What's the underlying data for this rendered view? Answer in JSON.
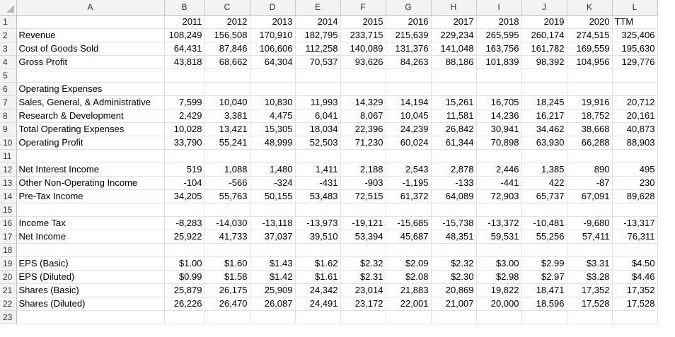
{
  "columns": [
    "A",
    "B",
    "C",
    "D",
    "E",
    "F",
    "G",
    "H",
    "I",
    "J",
    "K",
    "L"
  ],
  "rows": [
    {
      "n": "1",
      "label": "",
      "values": [
        "2011",
        "2012",
        "2013",
        "2014",
        "2015",
        "2016",
        "2017",
        "2018",
        "2019",
        "2020",
        "TTM"
      ]
    },
    {
      "n": "2",
      "label": "Revenue",
      "values": [
        "108,249",
        "156,508",
        "170,910",
        "182,795",
        "233,715",
        "215,639",
        "229,234",
        "265,595",
        "260,174",
        "274,515",
        "325,406"
      ]
    },
    {
      "n": "3",
      "label": "Cost of Goods Sold",
      "values": [
        "64,431",
        "87,846",
        "106,606",
        "112,258",
        "140,089",
        "131,376",
        "141,048",
        "163,756",
        "161,782",
        "169,559",
        "195,630"
      ]
    },
    {
      "n": "4",
      "label": "Gross Profit",
      "values": [
        "43,818",
        "68,662",
        "64,304",
        "70,537",
        "93,626",
        "84,263",
        "88,186",
        "101,839",
        "98,392",
        "104,956",
        "129,776"
      ]
    },
    {
      "n": "5",
      "label": "",
      "values": [
        "",
        "",
        "",
        "",
        "",
        "",
        "",
        "",
        "",
        "",
        ""
      ]
    },
    {
      "n": "6",
      "label": "Operating Expenses",
      "values": [
        "",
        "",
        "",
        "",
        "",
        "",
        "",
        "",
        "",
        "",
        ""
      ]
    },
    {
      "n": "7",
      "label": "Sales, General, & Administrative",
      "values": [
        "7,599",
        "10,040",
        "10,830",
        "11,993",
        "14,329",
        "14,194",
        "15,261",
        "16,705",
        "18,245",
        "19,916",
        "20,712"
      ]
    },
    {
      "n": "8",
      "label": "Research & Development",
      "values": [
        "2,429",
        "3,381",
        "4,475",
        "6,041",
        "8,067",
        "10,045",
        "11,581",
        "14,236",
        "16,217",
        "18,752",
        "20,161"
      ]
    },
    {
      "n": "9",
      "label": "Total Operating Expenses",
      "values": [
        "10,028",
        "13,421",
        "15,305",
        "18,034",
        "22,396",
        "24,239",
        "26,842",
        "30,941",
        "34,462",
        "38,668",
        "40,873"
      ]
    },
    {
      "n": "10",
      "label": "Operating Profit",
      "values": [
        "33,790",
        "55,241",
        "48,999",
        "52,503",
        "71,230",
        "60,024",
        "61,344",
        "70,898",
        "63,930",
        "66,288",
        "88,903"
      ]
    },
    {
      "n": "11",
      "label": "",
      "values": [
        "",
        "",
        "",
        "",
        "",
        "",
        "",
        "",
        "",
        "",
        ""
      ]
    },
    {
      "n": "12",
      "label": "Net Interest Income",
      "values": [
        "519",
        "1,088",
        "1,480",
        "1,411",
        "2,188",
        "2,543",
        "2,878",
        "2,446",
        "1,385",
        "890",
        "495"
      ]
    },
    {
      "n": "13",
      "label": "Other Non-Operating Income",
      "values": [
        "-104",
        "-566",
        "-324",
        "-431",
        "-903",
        "-1,195",
        "-133",
        "-441",
        "422",
        "-87",
        "230"
      ]
    },
    {
      "n": "14",
      "label": "Pre-Tax Income",
      "values": [
        "34,205",
        "55,763",
        "50,155",
        "53,483",
        "72,515",
        "61,372",
        "64,089",
        "72,903",
        "65,737",
        "67,091",
        "89,628"
      ]
    },
    {
      "n": "15",
      "label": "",
      "values": [
        "",
        "",
        "",
        "",
        "",
        "",
        "",
        "",
        "",
        "",
        ""
      ]
    },
    {
      "n": "16",
      "label": "Income Tax",
      "values": [
        "-8,283",
        "-14,030",
        "-13,118",
        "-13,973",
        "-19,121",
        "-15,685",
        "-15,738",
        "-13,372",
        "-10,481",
        "-9,680",
        "-13,317"
      ]
    },
    {
      "n": "17",
      "label": "Net Income",
      "values": [
        "25,922",
        "41,733",
        "37,037",
        "39,510",
        "53,394",
        "45,687",
        "48,351",
        "59,531",
        "55,256",
        "57,411",
        "76,311"
      ]
    },
    {
      "n": "18",
      "label": "",
      "values": [
        "",
        "",
        "",
        "",
        "",
        "",
        "",
        "",
        "",
        "",
        ""
      ]
    },
    {
      "n": "19",
      "label": "EPS (Basic)",
      "values": [
        "$1.00",
        "$1.60",
        "$1.43",
        "$1.62",
        "$2.32",
        "$2.09",
        "$2.32",
        "$3.00",
        "$2.99",
        "$3.31",
        "$4.50"
      ]
    },
    {
      "n": "20",
      "label": "EPS (Diluted)",
      "values": [
        "$0.99",
        "$1.58",
        "$1.42",
        "$1.61",
        "$2.31",
        "$2.08",
        "$2.30",
        "$2.98",
        "$2.97",
        "$3.28",
        "$4.46"
      ]
    },
    {
      "n": "21",
      "label": "Shares (Basic)",
      "values": [
        "25,879",
        "26,175",
        "25,909",
        "24,342",
        "23,014",
        "21,883",
        "20,869",
        "19,822",
        "18,471",
        "17,352",
        "17,352"
      ]
    },
    {
      "n": "22",
      "label": "Shares (Diluted)",
      "values": [
        "26,226",
        "26,470",
        "26,087",
        "24,491",
        "23,172",
        "22,001",
        "21,007",
        "20,000",
        "18,596",
        "17,528",
        "17,528"
      ]
    },
    {
      "n": "23",
      "label": "",
      "values": [
        "",
        "",
        "",
        "",
        "",
        "",
        "",
        "",
        "",
        "",
        ""
      ]
    }
  ]
}
